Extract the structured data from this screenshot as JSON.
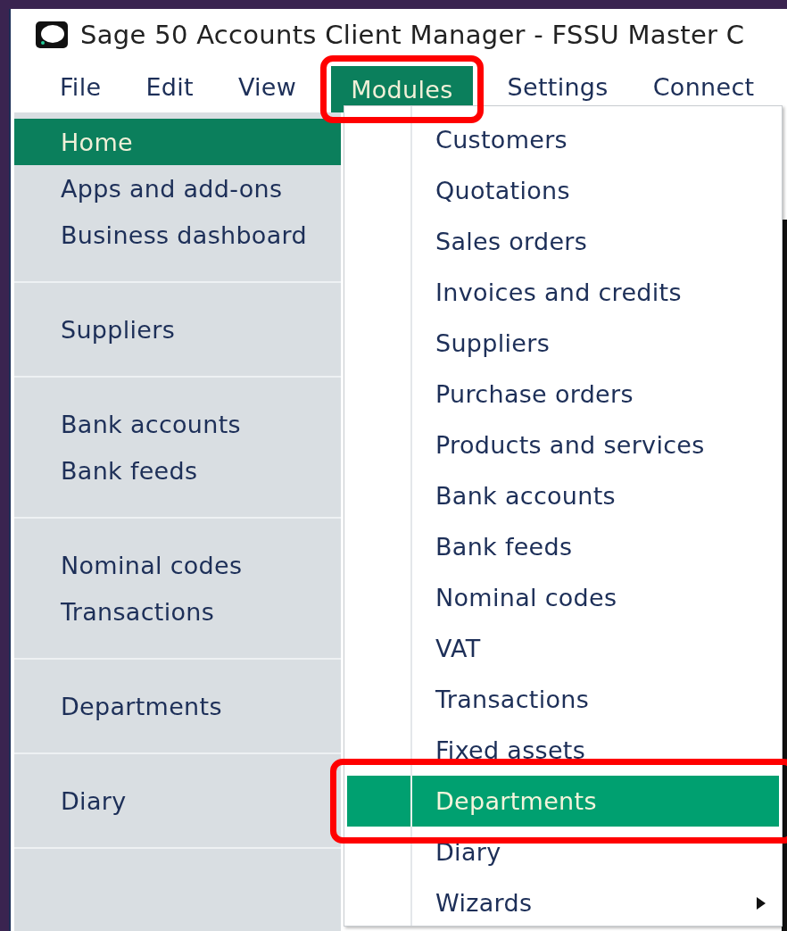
{
  "window": {
    "title": "Sage 50 Accounts Client Manager - FSSU Master C"
  },
  "menu_bar": [
    {
      "label": "File",
      "selected": false,
      "annotated": false
    },
    {
      "label": "Edit",
      "selected": false,
      "annotated": false
    },
    {
      "label": "View",
      "selected": false,
      "annotated": false
    },
    {
      "label": "Modules",
      "selected": true,
      "annotated": true
    },
    {
      "label": "Settings",
      "selected": false,
      "annotated": false
    },
    {
      "label": "Connect",
      "selected": false,
      "annotated": false
    }
  ],
  "sidebar": {
    "groups": [
      {
        "items": [
          {
            "label": "Home",
            "selected": true
          },
          {
            "label": "Apps and add-ons",
            "selected": false
          },
          {
            "label": "Business dashboard",
            "selected": false
          }
        ]
      },
      {
        "items": [
          {
            "label": "Suppliers",
            "selected": false
          }
        ]
      },
      {
        "items": [
          {
            "label": "Bank accounts",
            "selected": false
          },
          {
            "label": "Bank feeds",
            "selected": false
          }
        ]
      },
      {
        "items": [
          {
            "label": "Nominal codes",
            "selected": false
          },
          {
            "label": "Transactions",
            "selected": false
          }
        ]
      },
      {
        "items": [
          {
            "label": "Departments",
            "selected": false
          }
        ]
      },
      {
        "items": [
          {
            "label": "Diary",
            "selected": false
          }
        ]
      }
    ]
  },
  "modules_menu": [
    {
      "label": "Customers",
      "selected": false,
      "submenu": false,
      "annotated": false
    },
    {
      "label": "Quotations",
      "selected": false,
      "submenu": false,
      "annotated": false
    },
    {
      "label": "Sales orders",
      "selected": false,
      "submenu": false,
      "annotated": false
    },
    {
      "label": "Invoices and credits",
      "selected": false,
      "submenu": false,
      "annotated": false
    },
    {
      "label": "Suppliers",
      "selected": false,
      "submenu": false,
      "annotated": false
    },
    {
      "label": "Purchase orders",
      "selected": false,
      "submenu": false,
      "annotated": false
    },
    {
      "label": "Products and services",
      "selected": false,
      "submenu": false,
      "annotated": false
    },
    {
      "label": "Bank accounts",
      "selected": false,
      "submenu": false,
      "annotated": false
    },
    {
      "label": "Bank feeds",
      "selected": false,
      "submenu": false,
      "annotated": false
    },
    {
      "label": "Nominal codes",
      "selected": false,
      "submenu": false,
      "annotated": false
    },
    {
      "label": "VAT",
      "selected": false,
      "submenu": false,
      "annotated": false
    },
    {
      "label": "Transactions",
      "selected": false,
      "submenu": false,
      "annotated": false
    },
    {
      "label": "Fixed assets",
      "selected": false,
      "submenu": false,
      "annotated": false
    },
    {
      "label": "Departments",
      "selected": true,
      "submenu": false,
      "annotated": true
    },
    {
      "label": "Diary",
      "selected": false,
      "submenu": false,
      "annotated": false
    },
    {
      "label": "Wizards",
      "selected": false,
      "submenu": true,
      "annotated": false
    }
  ]
}
